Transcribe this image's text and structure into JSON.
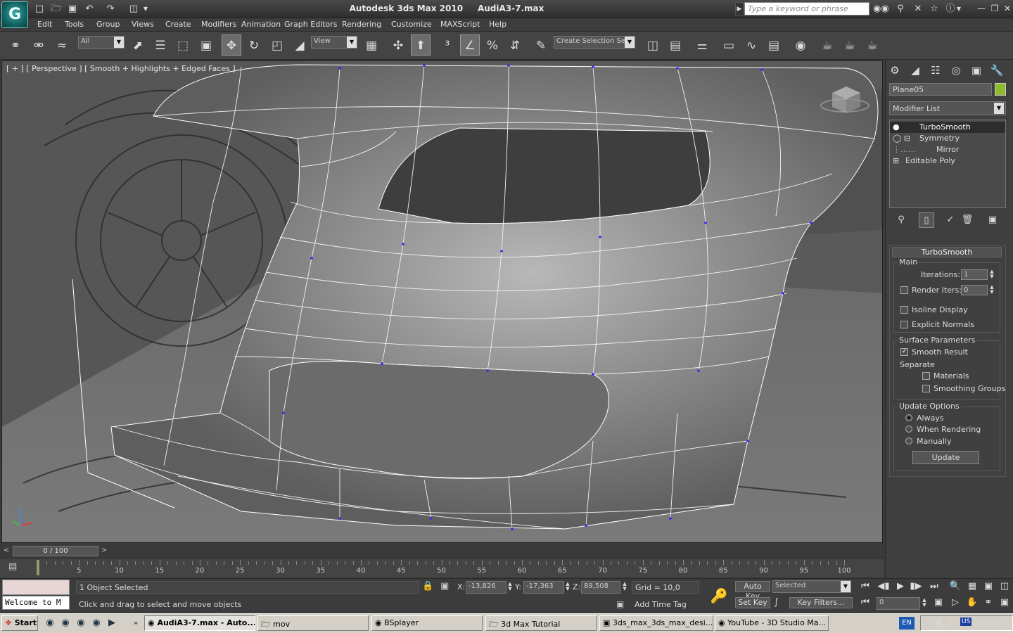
{
  "titlebar": {
    "app_title": "Autodesk 3ds Max  2010",
    "file_title": "AudiA3-7.max",
    "search_placeholder": "Type a keyword or phrase",
    "logo_glyph": "G"
  },
  "menu": [
    "Edit",
    "Tools",
    "Group",
    "Views",
    "Create",
    "Modifiers",
    "Animation",
    "Graph Editors",
    "Rendering",
    "Customize",
    "MAXScript",
    "Help"
  ],
  "toolbar": {
    "selection_filter": "All",
    "ref_coord": "View",
    "named_selection": "Create Selection Se"
  },
  "viewport": {
    "label": "[ + ] [ Perspective ] [ Smooth + Highlights + Edged Faces ]"
  },
  "command_panel": {
    "object_name": "Plane05",
    "object_color": "#8dbb2b",
    "modifier_list": "Modifier List",
    "stack": [
      "TurboSmooth",
      "Symmetry",
      "Mirror",
      "Editable Poly"
    ],
    "rollout_title": "TurboSmooth",
    "main_label": "Main",
    "iterations_label": "Iterations:",
    "iterations_value": "1",
    "render_iters_label": "Render Iters:",
    "render_iters_value": "0",
    "isoline_label": "Isoline Display",
    "explicit_normals_label": "Explicit Normals",
    "surface_params_label": "Surface Parameters",
    "smooth_result_label": "Smooth Result",
    "separate_label": "Separate",
    "materials_label": "Materials",
    "smoothing_groups_label": "Smoothing Groups",
    "update_options_label": "Update Options",
    "always_label": "Always",
    "when_rendering_label": "When Rendering",
    "manually_label": "Manually",
    "update_button": "Update"
  },
  "timeline": {
    "slider_text": "0 / 100",
    "ticks": [
      "5",
      "10",
      "15",
      "20",
      "25",
      "30",
      "35",
      "40",
      "45",
      "50",
      "55",
      "60",
      "65",
      "70",
      "75",
      "80",
      "85",
      "90",
      "95",
      "100"
    ]
  },
  "status": {
    "listener": "Welcome to M",
    "selection": "1 Object Selected",
    "prompt": "Click and drag to select and move objects",
    "x_label": "X:",
    "x_value": "-13,826",
    "y_label": "Y:",
    "y_value": "-17,363",
    "z_label": "Z:",
    "z_value": "89,508",
    "grid": "Grid = 10,0",
    "add_time_tag": "Add Time Tag",
    "auto_key": "Auto Key",
    "set_key": "Set Key",
    "key_mode": "Selected",
    "key_filters": "Key Filters...",
    "frame_value": "0"
  },
  "taskbar": {
    "start": "Start",
    "tasks": [
      "AudiA3-7.max - Auto...",
      "mov",
      "BSplayer",
      "3d Max Tutorial",
      "3ds_max_3ds_max_desi...",
      "YouTube - 3D Studio Ma..."
    ],
    "lang": "EN",
    "kbd": "US",
    "clock": "10:47"
  }
}
